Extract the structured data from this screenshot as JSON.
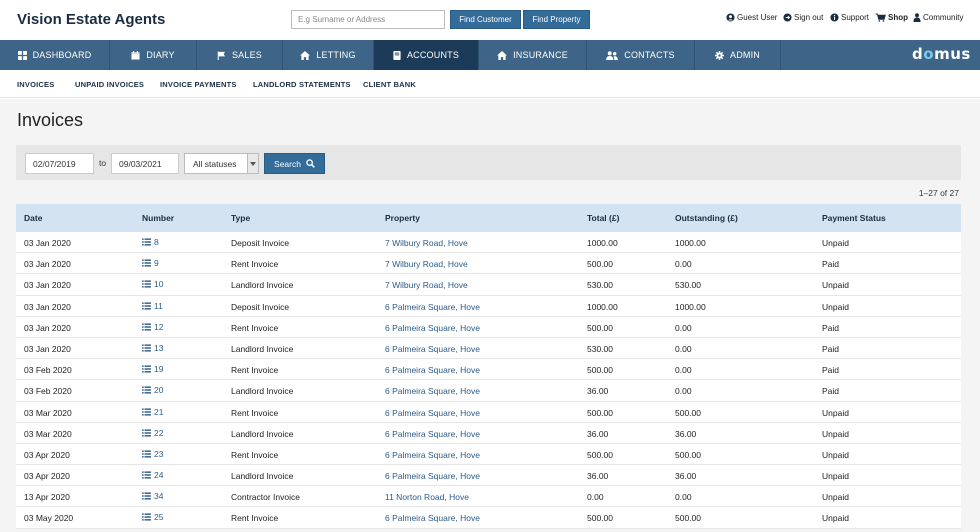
{
  "header": {
    "brand": "Vision Estate Agents",
    "search_placeholder": "E.g Surname or Address",
    "find_customer": "Find Customer",
    "find_property": "Find Property",
    "utilities": {
      "guest_user": "Guest User",
      "sign_out": "Sign out",
      "support": "Support",
      "shop": "Shop",
      "community": "Community"
    }
  },
  "nav": {
    "items": [
      "DASHBOARD",
      "DIARY",
      "SALES",
      "LETTING",
      "ACCOUNTS",
      "INSURANCE",
      "CONTACTS",
      "ADMIN"
    ],
    "active": "ACCOUNTS",
    "logo_a": "d",
    "logo_o": "o",
    "logo_b": "mus"
  },
  "subnav": {
    "items": [
      "INVOICES",
      "UNPAID INVOICES",
      "INVOICE PAYMENTS",
      "LANDLORD STATEMENTS",
      "CLIENT BANK"
    ]
  },
  "page": {
    "title": "Invoices"
  },
  "filters": {
    "date_from": "02/07/2019",
    "to_label": "to",
    "date_to": "09/03/2021",
    "status": "All statuses",
    "search_label": "Search"
  },
  "pagination": {
    "range": "1–27 of 27"
  },
  "table": {
    "columns": [
      "Date",
      "Number",
      "Type",
      "Property",
      "Total (£)",
      "Outstanding (£)",
      "Payment Status"
    ],
    "rows": [
      {
        "date": "03 Jan 2020",
        "number": "8",
        "type": "Deposit Invoice",
        "property": "7 Wilbury Road, Hove",
        "total": "1000.00",
        "outstanding": "1000.00",
        "status": "Unpaid"
      },
      {
        "date": "03 Jan 2020",
        "number": "9",
        "type": "Rent Invoice",
        "property": "7 Wilbury Road, Hove",
        "total": "500.00",
        "outstanding": "0.00",
        "status": "Paid"
      },
      {
        "date": "03 Jan 2020",
        "number": "10",
        "type": "Landlord Invoice",
        "property": "7 Wilbury Road, Hove",
        "total": "530.00",
        "outstanding": "530.00",
        "status": "Unpaid"
      },
      {
        "date": "03 Jan 2020",
        "number": "11",
        "type": "Deposit Invoice",
        "property": "6 Palmeira Square, Hove",
        "total": "1000.00",
        "outstanding": "1000.00",
        "status": "Unpaid"
      },
      {
        "date": "03 Jan 2020",
        "number": "12",
        "type": "Rent Invoice",
        "property": "6 Palmeira Square, Hove",
        "total": "500.00",
        "outstanding": "0.00",
        "status": "Paid"
      },
      {
        "date": "03 Jan 2020",
        "number": "13",
        "type": "Landlord Invoice",
        "property": "6 Palmeira Square, Hove",
        "total": "530.00",
        "outstanding": "0.00",
        "status": "Paid"
      },
      {
        "date": "03 Feb 2020",
        "number": "19",
        "type": "Rent Invoice",
        "property": "6 Palmeira Square, Hove",
        "total": "500.00",
        "outstanding": "0.00",
        "status": "Paid"
      },
      {
        "date": "03 Feb 2020",
        "number": "20",
        "type": "Landlord Invoice",
        "property": "6 Palmeira Square, Hove",
        "total": "36.00",
        "outstanding": "0.00",
        "status": "Paid"
      },
      {
        "date": "03 Mar 2020",
        "number": "21",
        "type": "Rent Invoice",
        "property": "6 Palmeira Square, Hove",
        "total": "500.00",
        "outstanding": "500.00",
        "status": "Unpaid"
      },
      {
        "date": "03 Mar 2020",
        "number": "22",
        "type": "Landlord Invoice",
        "property": "6 Palmeira Square, Hove",
        "total": "36.00",
        "outstanding": "36.00",
        "status": "Unpaid"
      },
      {
        "date": "03 Apr 2020",
        "number": "23",
        "type": "Rent Invoice",
        "property": "6 Palmeira Square, Hove",
        "total": "500.00",
        "outstanding": "500.00",
        "status": "Unpaid"
      },
      {
        "date": "03 Apr 2020",
        "number": "24",
        "type": "Landlord Invoice",
        "property": "6 Palmeira Square, Hove",
        "total": "36.00",
        "outstanding": "36.00",
        "status": "Unpaid"
      },
      {
        "date": "13 Apr 2020",
        "number": "34",
        "type": "Contractor Invoice",
        "property": "11 Norton Road, Hove",
        "total": "0.00",
        "outstanding": "0.00",
        "status": "Unpaid"
      },
      {
        "date": "03 May 2020",
        "number": "25",
        "type": "Rent Invoice",
        "property": "6 Palmeira Square, Hove",
        "total": "500.00",
        "outstanding": "500.00",
        "status": "Unpaid"
      }
    ]
  },
  "colors": {
    "nav_bg": "#3e6587",
    "nav_active": "#1c3b59",
    "button": "#336b99",
    "table_header": "#d3e3f1",
    "link": "#2a5b8a"
  }
}
